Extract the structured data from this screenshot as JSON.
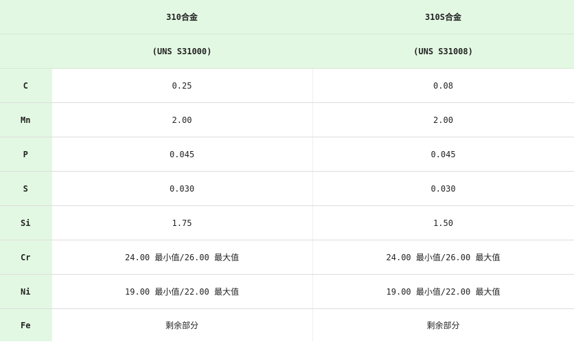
{
  "header": {
    "row1": [
      "",
      "310合金",
      "310S合金"
    ],
    "row2": [
      "",
      "(UNS S31000)",
      "(UNS S31008)"
    ]
  },
  "rows": [
    {
      "element": "C",
      "alloy310": "0.25",
      "alloy310s": "0.08"
    },
    {
      "element": "Mn",
      "alloy310": "2.00",
      "alloy310s": "2.00"
    },
    {
      "element": "P",
      "alloy310": "0.045",
      "alloy310s": "0.045"
    },
    {
      "element": "S",
      "alloy310": "0.030",
      "alloy310s": "0.030"
    },
    {
      "element": "Si",
      "alloy310": "1.75",
      "alloy310s": "1.50"
    },
    {
      "element": "Cr",
      "alloy310": "24.00 最小值/26.00 最大值",
      "alloy310s": "24.00 最小值/26.00 最大值"
    },
    {
      "element": "Ni",
      "alloy310": "19.00 最小值/22.00 最大值",
      "alloy310s": "19.00 最小值/22.00 最大值"
    },
    {
      "element": "Fe",
      "alloy310": "剩余部分",
      "alloy310s": "剩余部分"
    }
  ]
}
